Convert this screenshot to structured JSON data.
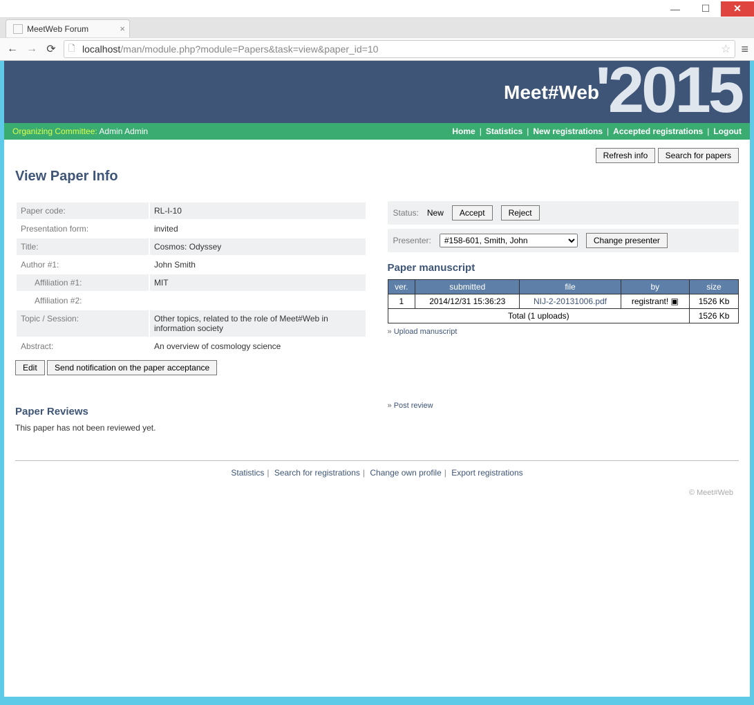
{
  "window": {
    "tab_title": "MeetWeb Forum"
  },
  "url": {
    "host": "localhost",
    "path": "/man/module.php?module=Papers&task=view&paper_id=10"
  },
  "banner": {
    "title": "Meet#Web",
    "year": "'2015"
  },
  "greenbar": {
    "role_label": "Organizing Committee: ",
    "user": "Admin Admin",
    "links": [
      "Home",
      "Statistics",
      "New registrations",
      "Accepted registrations",
      "Logout"
    ]
  },
  "top_buttons": {
    "refresh": "Refresh info",
    "search": "Search for papers"
  },
  "page_title": "View Paper Info",
  "info": {
    "paper_code_label": "Paper code:",
    "paper_code": "RL-I-10",
    "form_label": "Presentation form:",
    "form": "invited",
    "title_label": "Title:",
    "title": "Cosmos: Odyssey",
    "author_label": "Author #1:",
    "author": "John Smith",
    "affil1_label": "Affiliation #1:",
    "affil1": "MIT",
    "affil2_label": "Affiliation #2:",
    "affil2": "",
    "topic_label": "Topic / Session:",
    "topic": "Other topics, related to the role of Meet#Web in information society",
    "abstract_label": "Abstract:",
    "abstract": "An overview of cosmology science"
  },
  "info_buttons": {
    "edit": "Edit",
    "notify": "Send notification on the paper acceptance"
  },
  "status": {
    "label": "Status:",
    "value": "New",
    "accept": "Accept",
    "reject": "Reject"
  },
  "presenter": {
    "label": "Presenter:",
    "selected": "#158-601, Smith, John",
    "change": "Change presenter"
  },
  "manuscript": {
    "heading": "Paper manuscript",
    "columns": {
      "ver": "ver.",
      "submitted": "submitted",
      "file": "file",
      "by": "by",
      "size": "size"
    },
    "rows": [
      {
        "ver": "1",
        "submitted": "2014/12/31 15:36:23",
        "file": "NIJ-2-20131006.pdf",
        "by": "registrant! ▣",
        "size": "1526 Kb"
      }
    ],
    "total_label": "Total (1 uploads)",
    "total_size": "1526 Kb",
    "upload_link": "Upload manuscript"
  },
  "reviews": {
    "heading": "Paper Reviews",
    "post_link": "Post review",
    "empty_text": "This paper has not been reviewed yet."
  },
  "footer": {
    "links": [
      "Statistics",
      "Search for registrations",
      "Change own profile",
      "Export registrations"
    ],
    "copyright": "© Meet#Web"
  }
}
